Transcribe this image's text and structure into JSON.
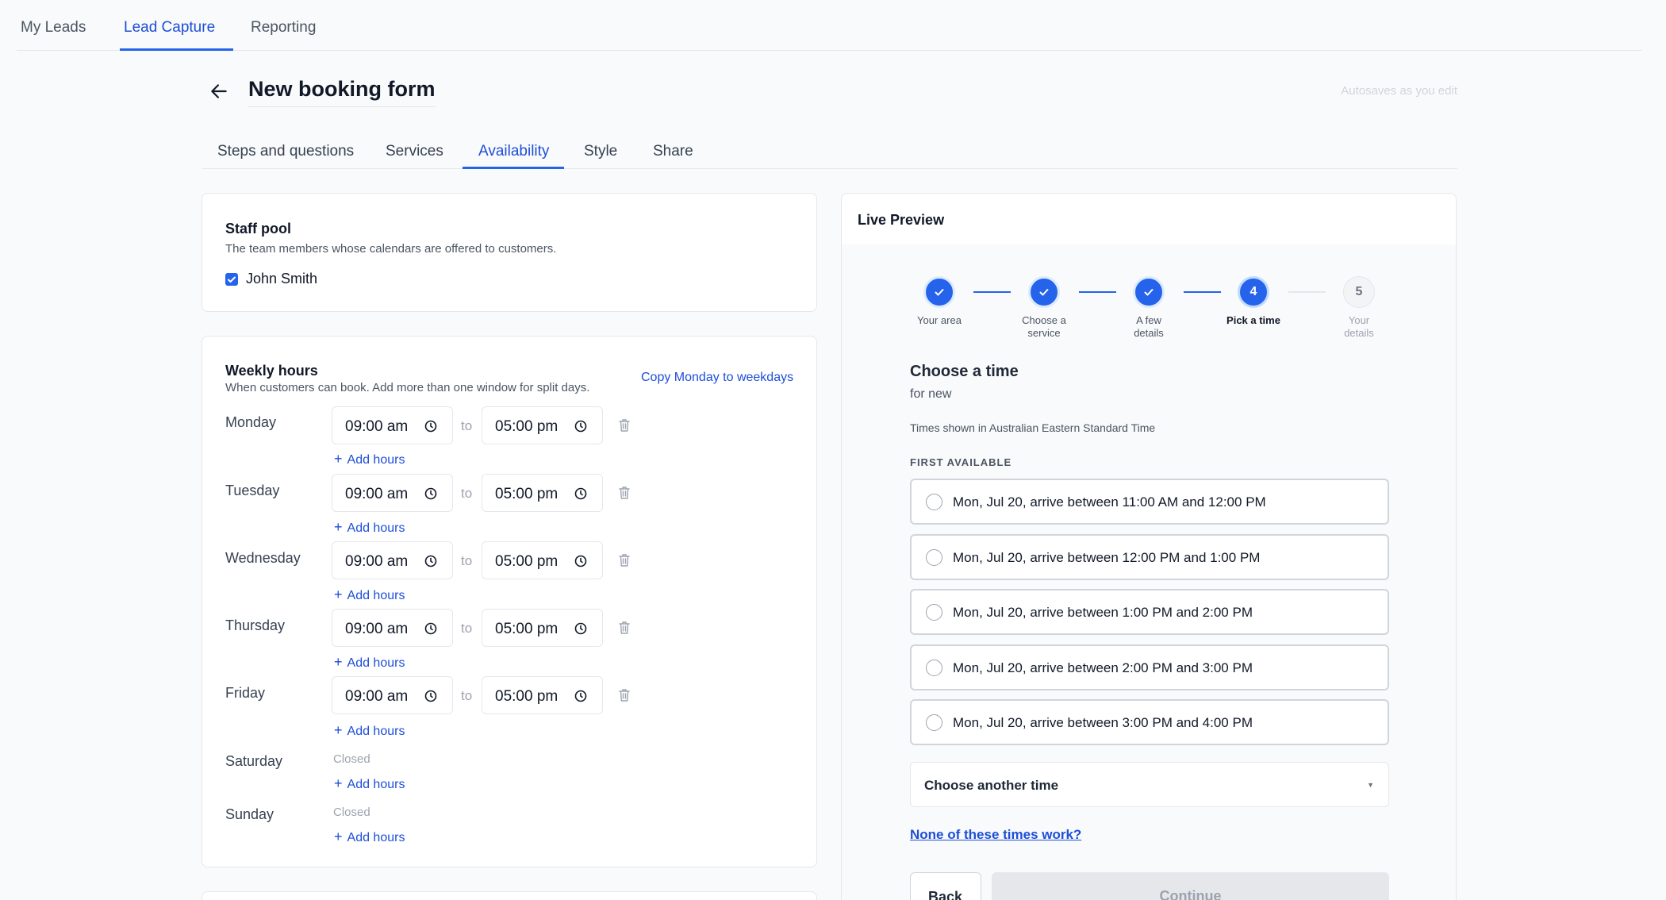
{
  "topnav": {
    "tabs": [
      {
        "label": "My Leads"
      },
      {
        "label": "Lead Capture"
      },
      {
        "label": "Reporting"
      }
    ]
  },
  "header": {
    "title": "New booking form",
    "autosave": "Autosaves as you edit"
  },
  "subtabs": [
    {
      "label": "Steps and questions"
    },
    {
      "label": "Services"
    },
    {
      "label": "Availability"
    },
    {
      "label": "Style"
    },
    {
      "label": "Share"
    }
  ],
  "active_subtab": "Availability",
  "staff_pool": {
    "title": "Staff pool",
    "subtitle": "The team members whose calendars are offered to customers.",
    "members": [
      {
        "name": "John Smith",
        "checked": true
      }
    ]
  },
  "weekly_hours": {
    "title": "Weekly hours",
    "subtitle": "When customers can book. Add more than one window for split days.",
    "copy_link": "Copy Monday to weekdays",
    "to_label": "to",
    "add_hours_label": "Add hours",
    "plus_symbol": "+",
    "closed_label": "Closed",
    "days": [
      {
        "name": "Monday",
        "start": "09:00 am",
        "end": "05:00 pm"
      },
      {
        "name": "Tuesday",
        "start": "09:00 am",
        "end": "05:00 pm"
      },
      {
        "name": "Wednesday",
        "start": "09:00 am",
        "end": "05:00 pm"
      },
      {
        "name": "Thursday",
        "start": "09:00 am",
        "end": "05:00 pm"
      },
      {
        "name": "Friday",
        "start": "09:00 am",
        "end": "05:00 pm"
      },
      {
        "name": "Saturday"
      },
      {
        "name": "Sunday"
      }
    ]
  },
  "preview": {
    "title": "Live Preview",
    "steps": [
      {
        "label": "Your area",
        "state": "done"
      },
      {
        "label": "Choose a service",
        "state": "done"
      },
      {
        "label": "A few details",
        "state": "done"
      },
      {
        "label": "Pick a time",
        "number": "4",
        "state": "current"
      },
      {
        "label": "Your details",
        "number": "5",
        "state": "todo"
      }
    ],
    "heading": "Choose a time",
    "subheading": "for new",
    "timezone_note": "Times shown in Australian Eastern Standard Time",
    "first_available_label": "FIRST AVAILABLE",
    "slots": [
      "Mon, Jul 20, arrive between 11:00 AM and 12:00 PM",
      "Mon, Jul 20, arrive between 12:00 PM and 1:00 PM",
      "Mon, Jul 20, arrive between 1:00 PM and 2:00 PM",
      "Mon, Jul 20, arrive between 2:00 PM and 3:00 PM",
      "Mon, Jul 20, arrive between 3:00 PM and 4:00 PM"
    ],
    "choose_another": "Choose another time",
    "none_work_link": "None of these times work?",
    "back_button": "Back",
    "continue_button": "Continue"
  },
  "colors": {
    "accent": "#2563eb",
    "link": "#1d4ed8",
    "page_bg": "#f9fafb"
  }
}
